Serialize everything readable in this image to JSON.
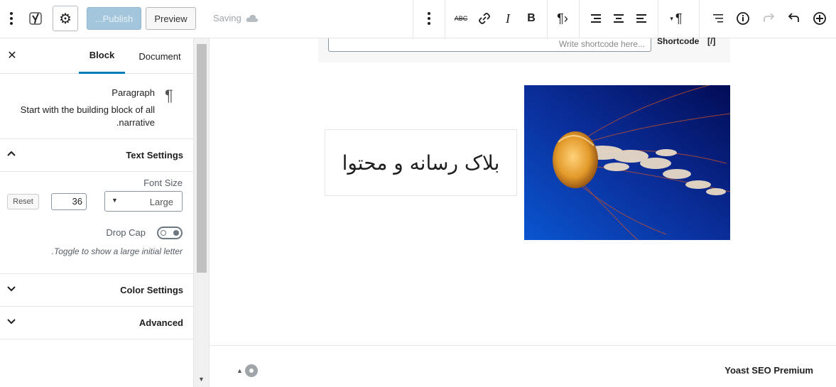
{
  "toolbar": {
    "publish_label": "...Publish",
    "preview_label": "Preview",
    "saving_label": "Saving",
    "right_icons": [
      "kebab-menu-icon",
      "strikethrough-icon",
      "link-icon",
      "italic-icon",
      "bold-icon",
      "text-direction-icon",
      "align-right-icon",
      "align-center-icon",
      "align-left-icon",
      "paragraph-icon",
      "block-navigation-icon",
      "info-icon",
      "redo-icon",
      "undo-icon",
      "add-block-icon"
    ],
    "left_icons": [
      "more-menu-icon",
      "yoast-icon",
      "gear-icon"
    ],
    "strike_label": "ABC"
  },
  "sidebar": {
    "tabs": {
      "block": "Block",
      "document": "Document"
    },
    "block_card": {
      "title": "Paragraph",
      "description": "Start with the building block of all narrative."
    },
    "text_settings": {
      "title": "Text Settings",
      "font_size_label": "Font Size",
      "font_size_select": "Large",
      "font_size_value": "36",
      "reset_label": "Reset",
      "drop_cap_label": "Drop Cap",
      "drop_cap_help": "Toggle to show a large initial letter.",
      "drop_cap_on": false
    },
    "color_settings_title": "Color Settings",
    "advanced_title": "Advanced"
  },
  "editor": {
    "shortcode_label": "Shortcode",
    "shortcode_icon": "[/]",
    "shortcode_placeholder": "Write shortcode here...",
    "media_text": "بلاک رسانه و محتوا"
  },
  "footer": {
    "title": "Yoast SEO Premium"
  },
  "colors": {
    "accent": "#007cba",
    "publish_disabled": "#a3c6dc"
  }
}
